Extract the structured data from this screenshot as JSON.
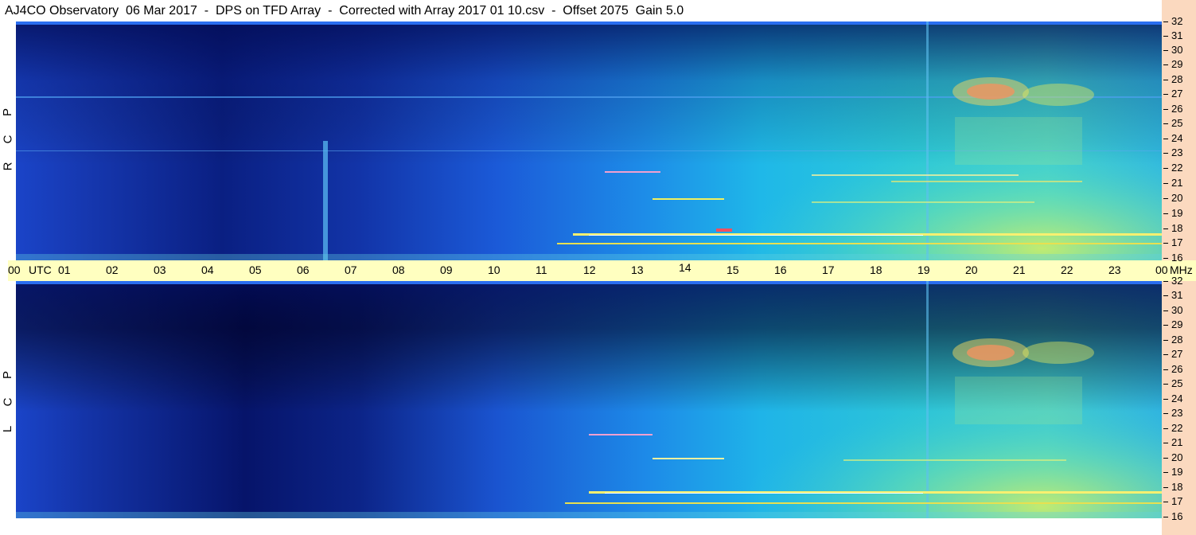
{
  "title": "AJ4CO Observatory  06 Mar 2017  -  DPS on TFD Array  -  Corrected with Array 2017 01 10.csv  -  Offset 2075  Gain 5.0",
  "top_panel_label": [
    "R",
    "C",
    "P"
  ],
  "bottom_panel_label": [
    "L",
    "C",
    "P"
  ],
  "utc_axis": {
    "labels": [
      "00",
      "01",
      "02",
      "03",
      "04",
      "05",
      "06",
      "07",
      "08",
      "09",
      "10",
      "11",
      "12",
      "13",
      "14",
      "15",
      "16",
      "17",
      "18",
      "19",
      "20",
      "21",
      "22",
      "23",
      "00"
    ],
    "utc_text": "UTC",
    "mhz_text": "MHz"
  },
  "freq_ticks": [
    "32",
    "31",
    "30",
    "29",
    "28",
    "27",
    "26",
    "25",
    "24",
    "23",
    "22",
    "21",
    "20",
    "19",
    "18",
    "17",
    "16"
  ],
  "colors": {
    "dark": "#06105a",
    "mid_blue": "#1c4fd8",
    "cyan": "#19c8e8",
    "green_yellow": "#c8f050",
    "axis_band": "#ffffc0",
    "right_strip": "#fbd9bf"
  }
}
